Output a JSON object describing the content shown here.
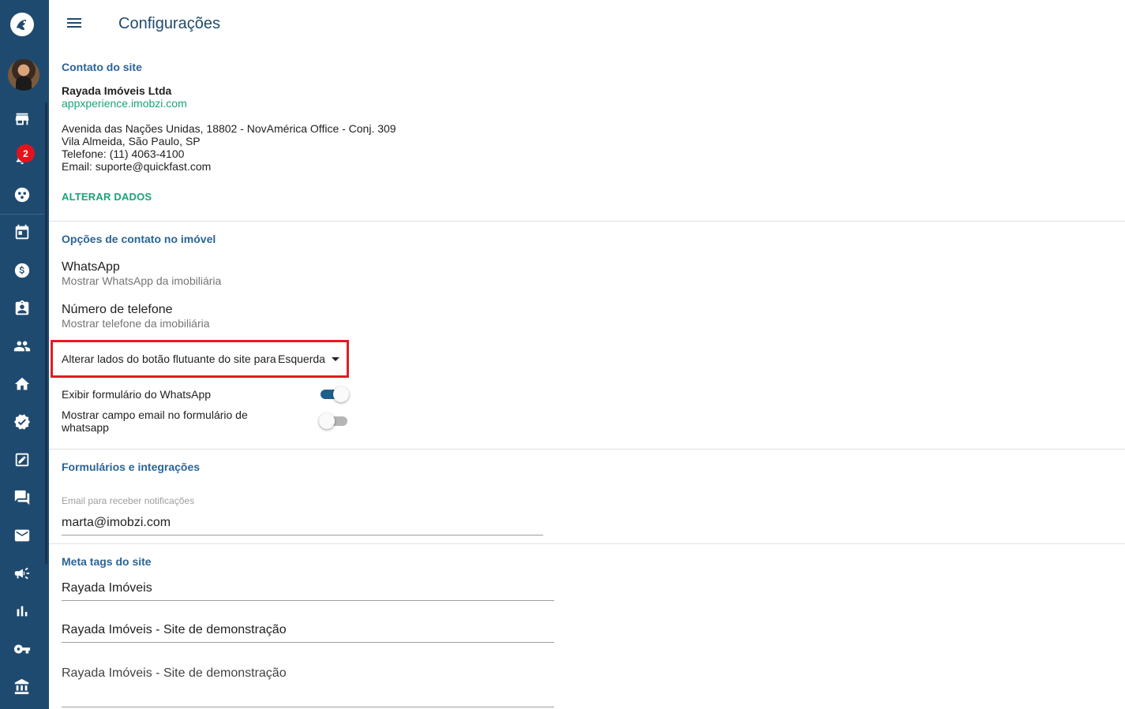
{
  "header": {
    "title": "Configurações"
  },
  "sidebar": {
    "notification_count": "2",
    "icons": [
      "logo-icon",
      "avatar",
      "store-icon",
      "bell-icon",
      "bubble-chart-icon",
      "calendar-icon",
      "dollar-icon",
      "assignment-ind-icon",
      "people-icon",
      "home-icon",
      "verified-icon",
      "edit-note-icon",
      "forum-icon",
      "mail-icon",
      "campaign-icon",
      "bar-chart-icon",
      "key-icon",
      "bank-icon"
    ]
  },
  "contact": {
    "section_title": "Contato do site",
    "company": "Rayada Imóveis Ltda",
    "site_url": "appxperience.imobzi.com",
    "address_line1": "Avenida das Nações Unidas, 18802 - NovAmérica Office - Conj. 309",
    "address_line2": "Vila Almeida, São Paulo, SP",
    "phone": "Telefone: (11) 4063-4100",
    "email": "Email: suporte@quickfast.com",
    "action_label": "ALTERAR DADOS"
  },
  "contact_options": {
    "section_title": "Opções de contato no imóvel",
    "whatsapp_title": "WhatsApp",
    "whatsapp_sub": "Mostrar WhatsApp da imobiliária",
    "phone_title": "Número de telefone",
    "phone_sub": "Mostrar telefone da imobiliária",
    "float_button_label": "Alterar lados do botão flutuante do site para",
    "float_button_value": "Esquerda",
    "toggle_whatsapp_form_label": "Exibir formulário do WhatsApp",
    "toggle_whatsapp_form_on": true,
    "toggle_email_field_label_line1": "Mostrar campo email no formulário de",
    "toggle_email_field_label_line2": "whatsapp",
    "toggle_email_field_on": false,
    "highlight_color": "#e31b23"
  },
  "forms": {
    "section_title": "Formulários e integrações",
    "notify_email_label": "Email para receber notificações",
    "notify_email_value": "marta@imobzi.com"
  },
  "meta": {
    "section_title": "Meta tags do site",
    "field1": "Rayada Imóveis",
    "field2": "Rayada Imóveis - Site de demonstração",
    "field3": "Rayada Imóveis - Site de demonstração"
  },
  "colors": {
    "sidebar_bg": "#1f4a70",
    "accent_green": "#1aa37a",
    "section_blue": "#2a6496"
  }
}
